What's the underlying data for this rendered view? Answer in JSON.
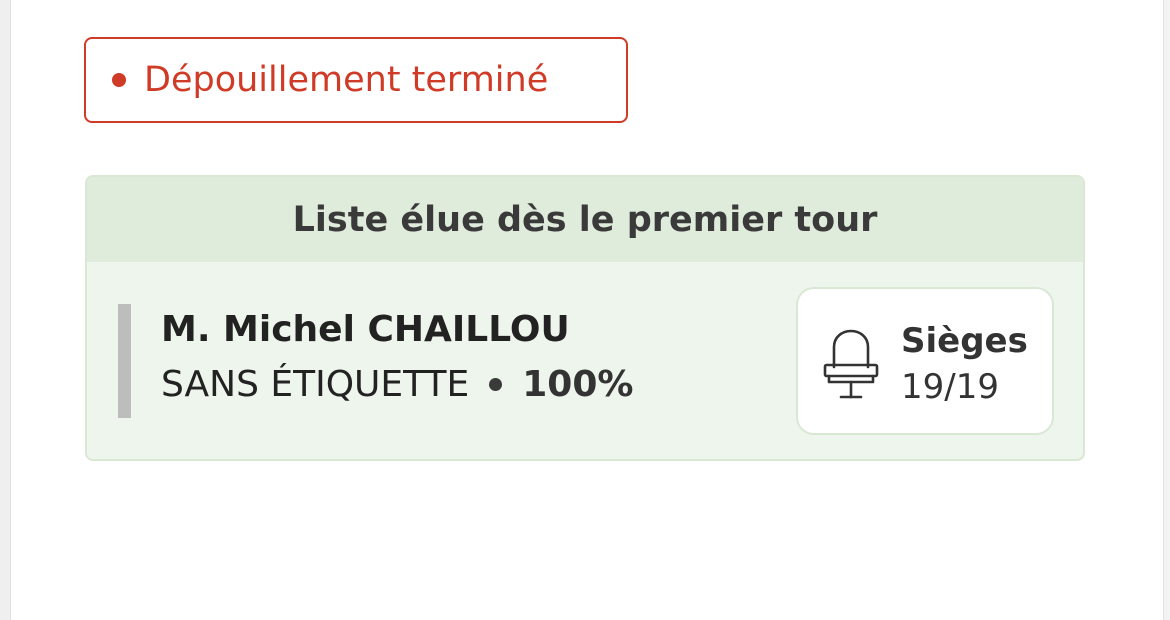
{
  "status": {
    "label": "Dépouillement terminé",
    "color": "#cf3b26"
  },
  "result": {
    "header": "Liste élue dès le premier tour",
    "candidate": {
      "name": "M. Michel CHAILLOU",
      "party": "SANS ÉTIQUETTE",
      "percentage": "100%"
    },
    "seats": {
      "label": "Sièges",
      "value": "19/19",
      "icon": "seat-icon"
    }
  }
}
